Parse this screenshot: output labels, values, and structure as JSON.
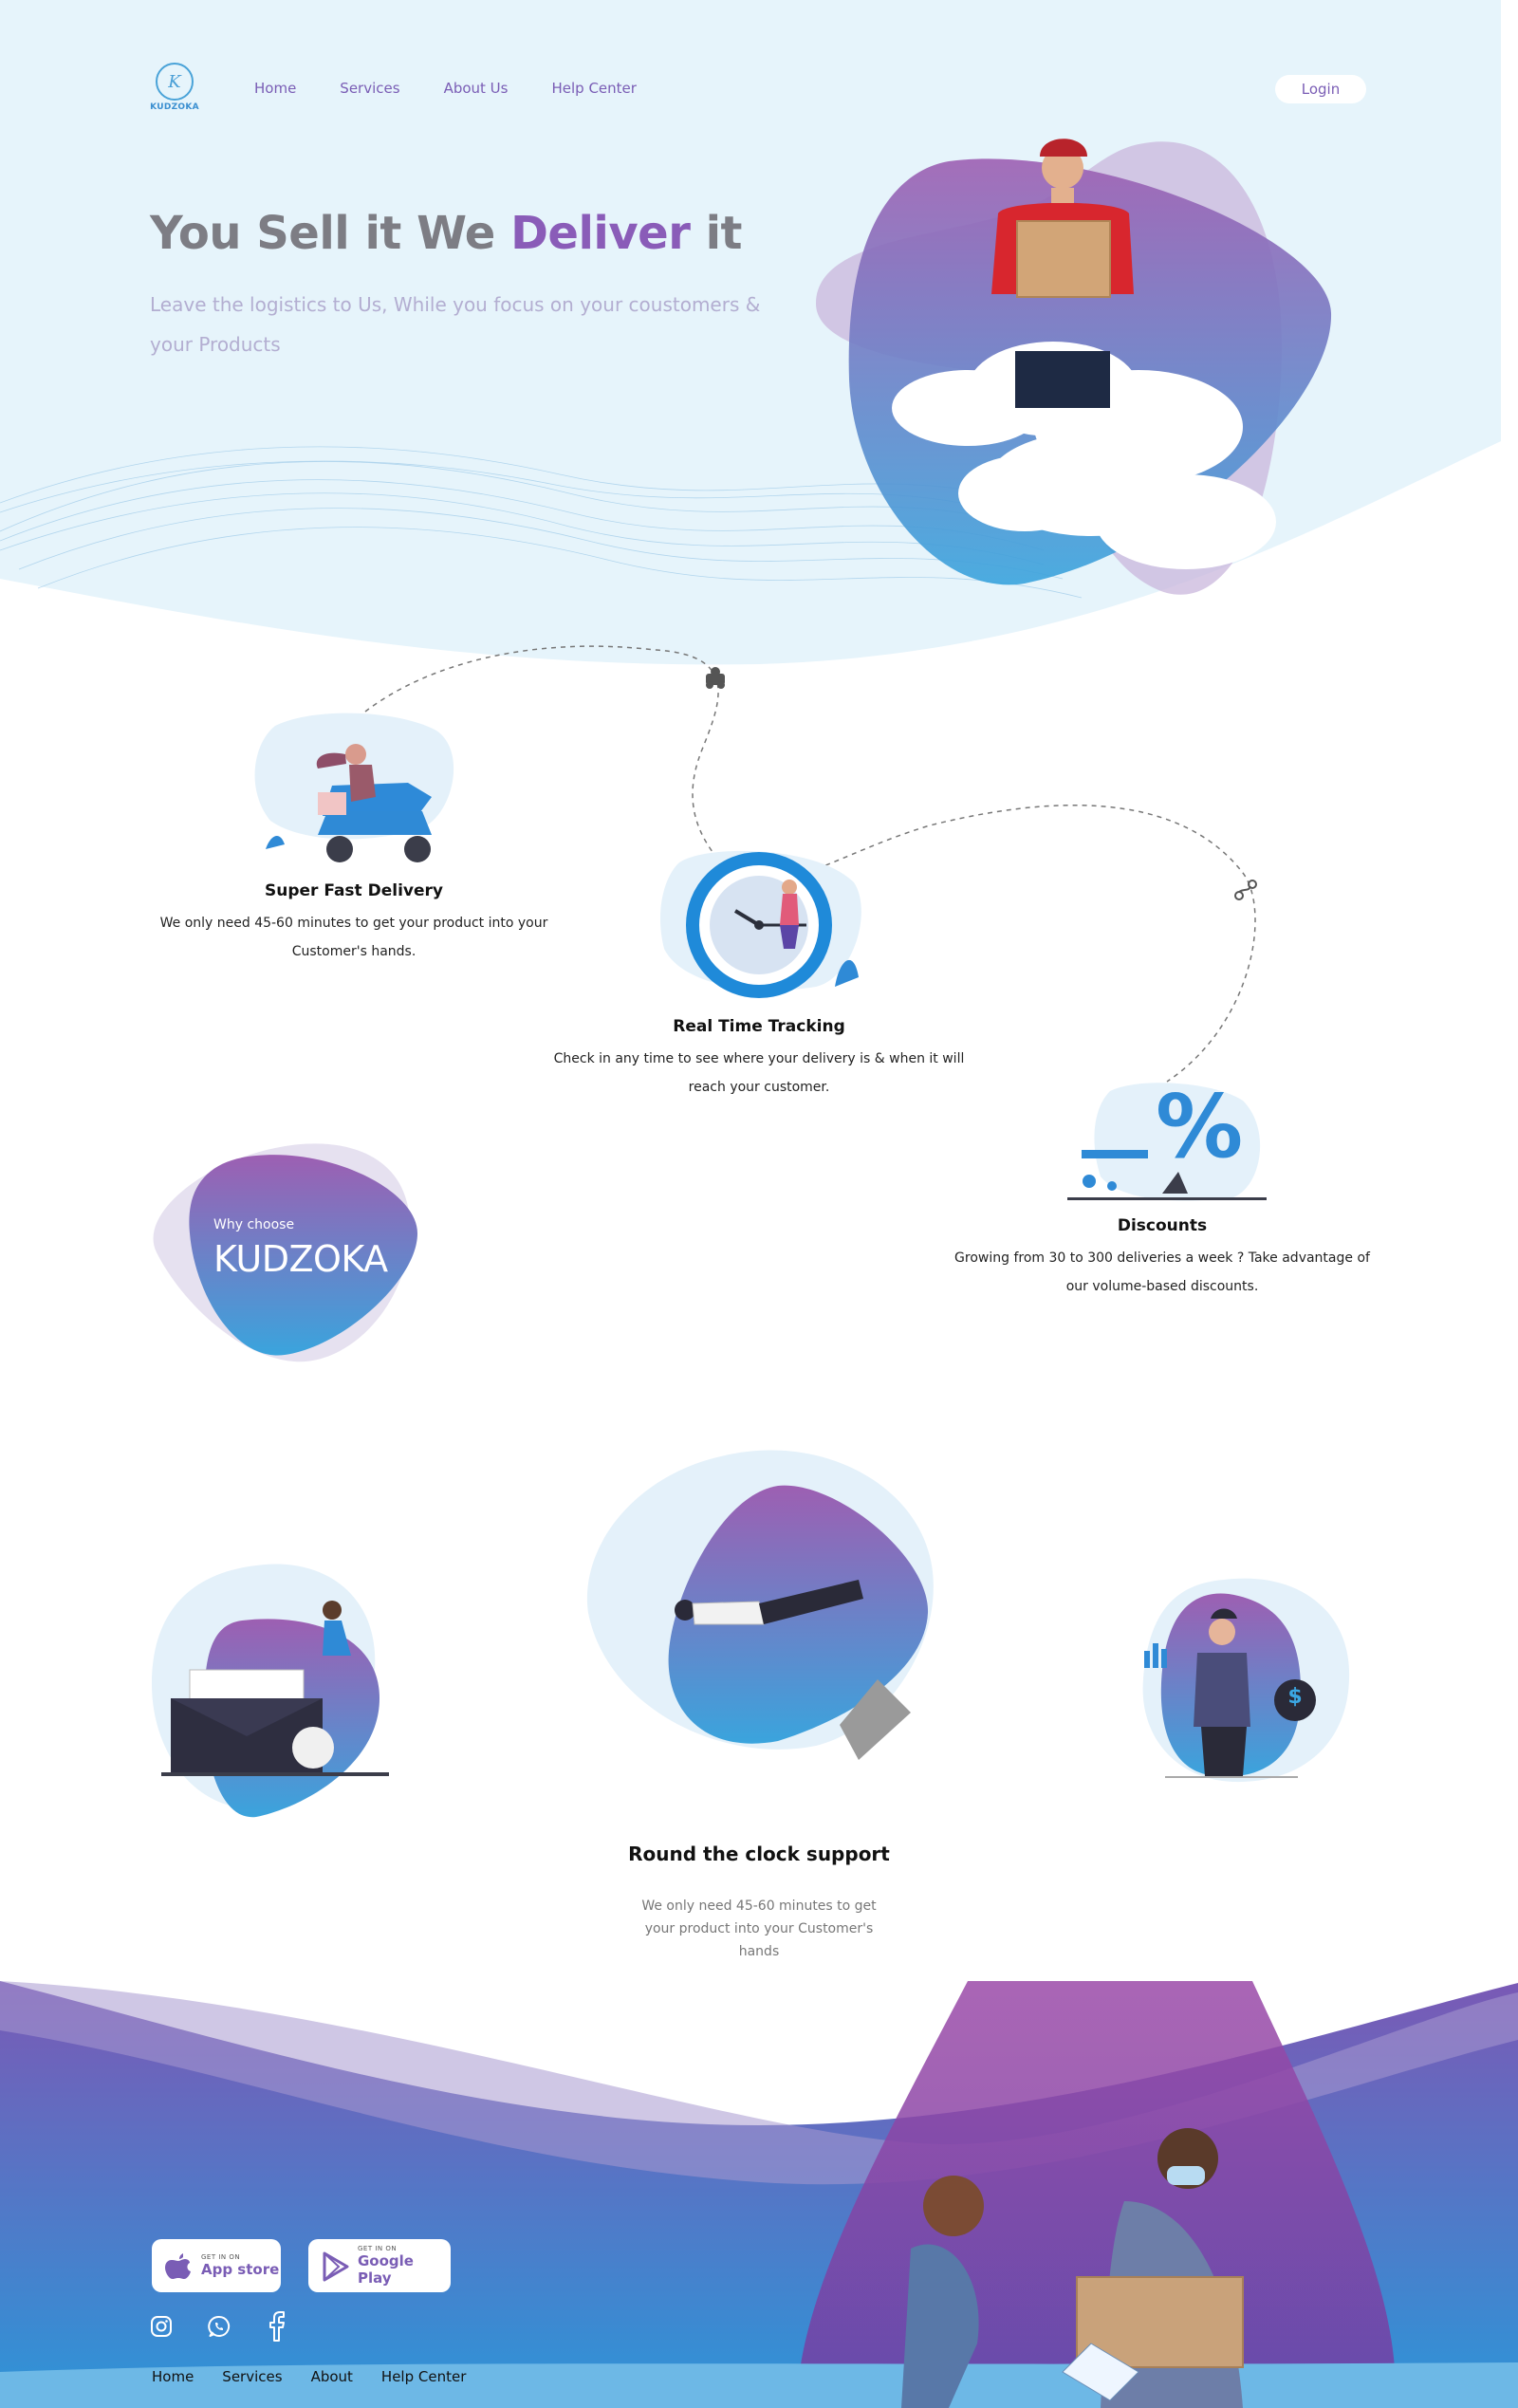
{
  "brand": {
    "name": "KUDZOKA",
    "mark": "K"
  },
  "nav": {
    "items": [
      "Home",
      "Services",
      "About Us",
      "Help Center"
    ],
    "login": "Login"
  },
  "hero": {
    "title_start": "You Sell it We ",
    "title_highlight": "Deliver",
    "title_end": " it",
    "subtitle": "Leave the logistics to Us, While you focus on your coustomers & your Products"
  },
  "features": [
    {
      "title": "Super Fast Delivery",
      "desc_line1": "We only need 45-60 minutes to get your product into your",
      "desc_line2": "Customer's hands."
    },
    {
      "title": "Real Time Tracking",
      "desc_line1": "Check in any time to see where your delivery is & when it will",
      "desc_line2": "reach your customer."
    },
    {
      "title": "Discounts",
      "desc_line1": "Growing from 30 to 300 deliveries a week ? Take advantage of",
      "desc_line2": "our volume-based discounts."
    }
  ],
  "why": {
    "small": "Why choose",
    "big": "KUDZOKA"
  },
  "percent_glyph": "%",
  "dollar_glyph": "$",
  "support": {
    "title": "Round the clock support",
    "desc": "We only need 45-60 minutes to get your product into your Customer's hands"
  },
  "footer": {
    "app_store_small": "GET IN ON",
    "app_store": "App store",
    "play_store_small": "GET IN ON",
    "play_store": "Google Play",
    "nav": [
      "Home",
      "Services",
      "About",
      "Help Center"
    ]
  },
  "colors": {
    "accent": "#8a5cb8",
    "blue": "#2f8fd8",
    "hero_bg": "#e6f4fb",
    "text_muted": "#b3aed1"
  },
  "icons": [
    "apple-icon",
    "play-store-icon",
    "instagram-icon",
    "whatsapp-icon",
    "facebook-icon"
  ]
}
